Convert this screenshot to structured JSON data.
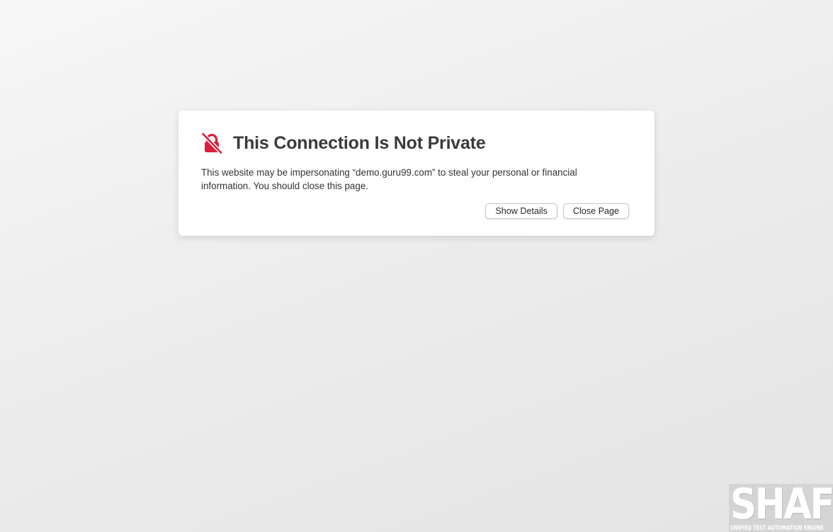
{
  "dialog": {
    "icon": "lock-slash-icon",
    "icon_color": "#d91f3c",
    "title": "This Connection Is Not Private",
    "message": "This website may be impersonating “demo.guru99.com” to steal your personal or financial information. You should close this page.",
    "buttons": {
      "show_details": "Show Details",
      "close_page": "Close Page"
    }
  },
  "watermark": {
    "logo_text": "SHAFT",
    "tagline": "UNIFIED TEST AUTOMATION ENGINE"
  }
}
